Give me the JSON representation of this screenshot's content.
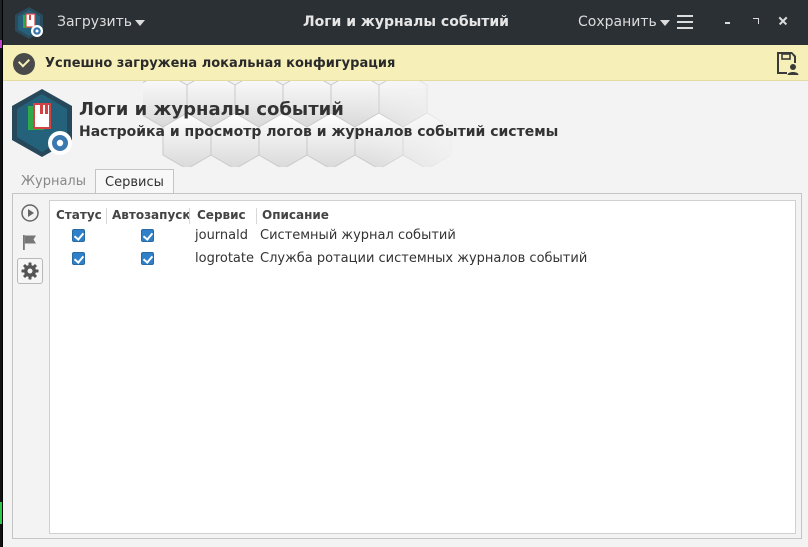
{
  "header": {
    "title": "Логи и журналы событий",
    "load_label": "Загрузить",
    "save_label": "Сохранить"
  },
  "infobar": {
    "message": "Успешно загружена локальная конфигурация"
  },
  "banner": {
    "title": "Логи и журналы событий",
    "subtitle": "Настройка и просмотр логов и журналов событий системы"
  },
  "tabs": [
    {
      "label": "Журналы",
      "active": false
    },
    {
      "label": "Сервисы",
      "active": true
    }
  ],
  "toolbar": {
    "icons": [
      "play-circle-icon",
      "flag-icon",
      "gear-icon"
    ]
  },
  "table": {
    "columns": [
      "Статус",
      "Автозапуск",
      "Сервис",
      "Описание"
    ],
    "rows": [
      {
        "status": true,
        "autostart": true,
        "service": "journald",
        "description": "Системный журнал событий"
      },
      {
        "status": true,
        "autostart": true,
        "service": "logrotate",
        "description": "Служба ротации системных журналов событий"
      }
    ]
  },
  "colors": {
    "headerbar": "#2b3034",
    "infobar": "#f6f0b8",
    "checkbox": "#2f80c8"
  }
}
